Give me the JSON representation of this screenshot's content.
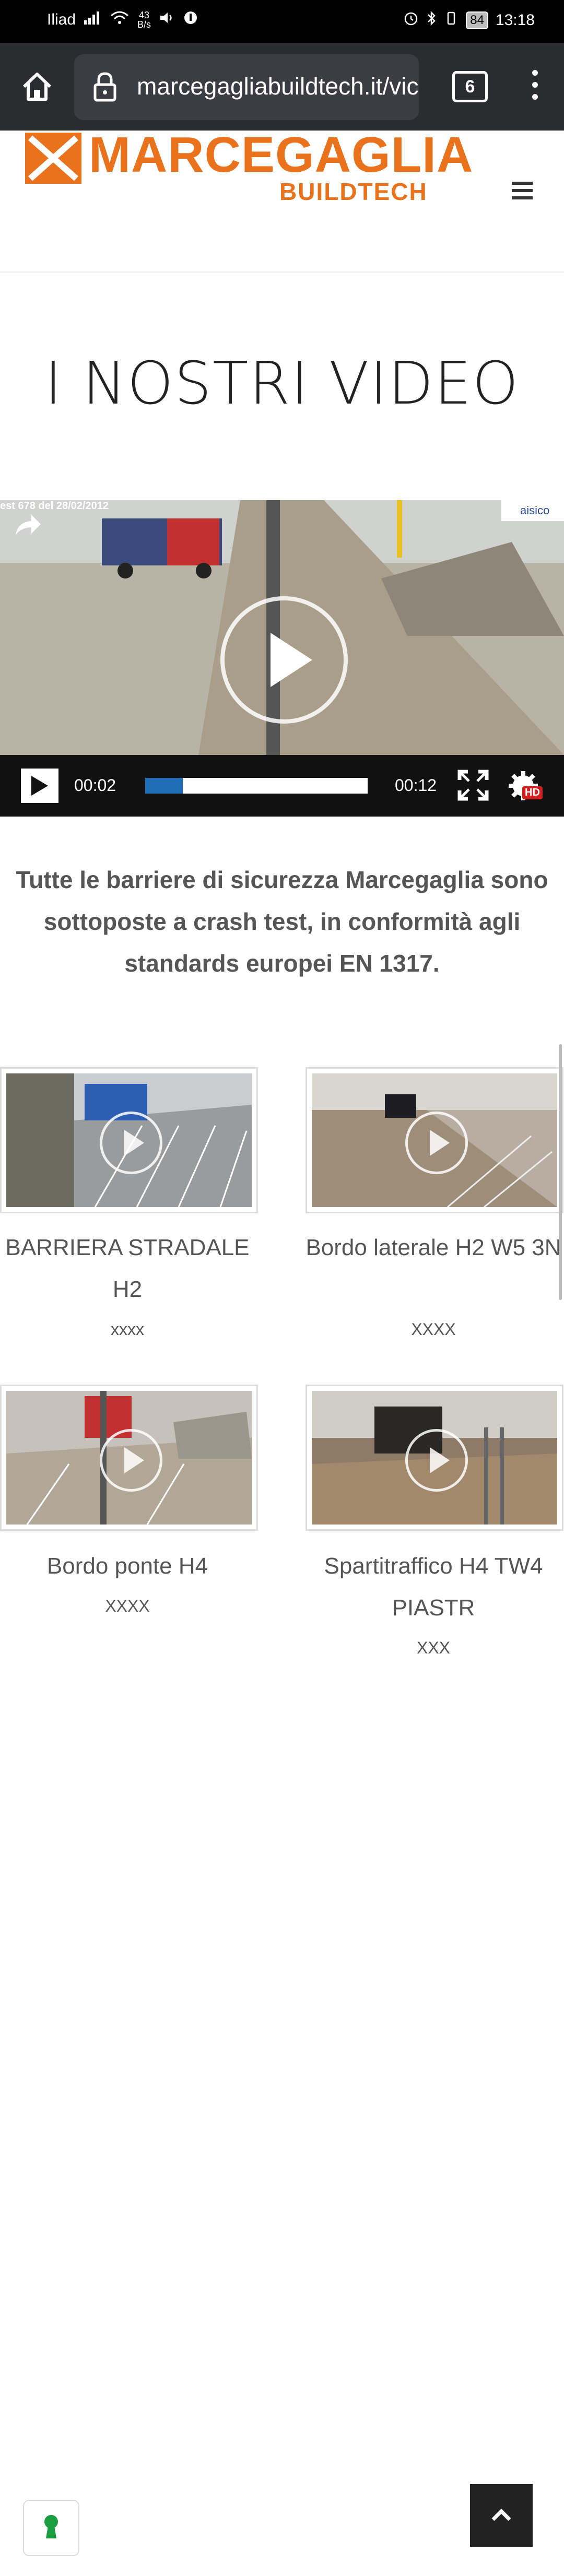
{
  "status_bar": {
    "carrier": "Iliad",
    "net_speed_value": "43",
    "net_speed_unit": "B/s",
    "battery": "84",
    "time": "13:18"
  },
  "browser": {
    "url": "marcegagliabuildtech.it/vic",
    "tab_count": "6"
  },
  "site": {
    "logo_main": "MARCEGAGLIA",
    "logo_sub": "BUILDTECH",
    "brand_color": "#e8731c"
  },
  "page": {
    "title": "I NOSTRI VIDEO"
  },
  "video": {
    "overlay_text": "est 678 del 28/02/2012",
    "watermark": "aisico",
    "current_time": "00:02",
    "duration": "00:12",
    "progress_fraction": 0.17,
    "hd_badge": "HD"
  },
  "description": "Tutte le barriere di sicurezza Marcegaglia sono sottoposte a crash test, in conformità agli standards europei EN 1317.",
  "videos": [
    {
      "title": "BARRIERA STRADALE H2",
      "subtitle": "xxxx"
    },
    {
      "title": "Bordo laterale H2 W5 3N",
      "subtitle": "XXXX"
    },
    {
      "title": "Bordo ponte H4",
      "subtitle": "XXXX"
    },
    {
      "title": "Spartitraffico H4 TW4 PIASTR",
      "subtitle": "XXX"
    }
  ]
}
